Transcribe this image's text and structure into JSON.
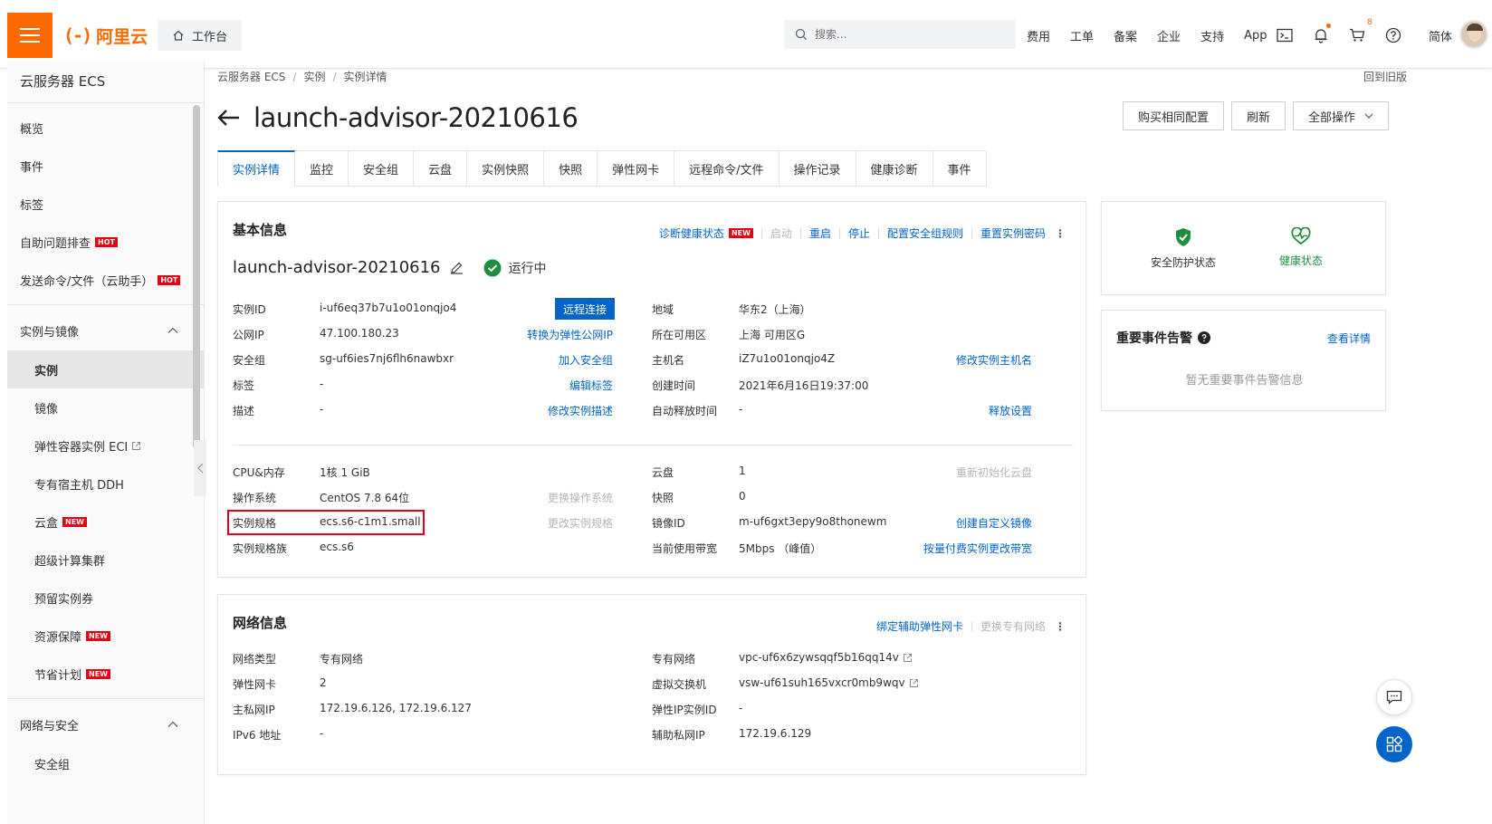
{
  "header": {
    "brand": "阿里云",
    "workbench": "工作台",
    "search_placeholder": "搜索...",
    "links": [
      "费用",
      "工单",
      "备案",
      "企业",
      "支持",
      "App"
    ],
    "cart_count": "8",
    "lang": "简体",
    "accent": "#ff6a00"
  },
  "sidebar": {
    "title": "云服务器 ECS",
    "top_items": [
      {
        "label": "概览"
      },
      {
        "label": "事件"
      },
      {
        "label": "标签"
      },
      {
        "label": "自助问题排查",
        "tag": "HOT"
      },
      {
        "label": "发送命令/文件（云助手）",
        "tag": "HOT"
      }
    ],
    "group1": "实例与镜像",
    "group1_items": [
      {
        "label": "实例"
      },
      {
        "label": "镜像"
      },
      {
        "label": "弹性容器实例 ECI"
      },
      {
        "label": "专有宿主机 DDH"
      },
      {
        "label": "云盒",
        "tag": "NEW"
      },
      {
        "label": "超级计算集群"
      },
      {
        "label": "预留实例券"
      },
      {
        "label": "资源保障",
        "tag": "NEW"
      },
      {
        "label": "节省计划",
        "tag": "NEW"
      }
    ],
    "group2": "网络与安全",
    "group2_items": [
      {
        "label": "安全组"
      }
    ]
  },
  "main": {
    "breadcrumb": [
      "云服务器 ECS",
      "实例",
      "实例详情"
    ],
    "back_old": "回到旧版",
    "title": "launch-advisor-20210616",
    "actions": {
      "buy_same": "购买相同配置",
      "refresh": "刷新",
      "all_ops": "全部操作"
    },
    "tabs": [
      "实例详情",
      "监控",
      "安全组",
      "云盘",
      "实例快照",
      "快照",
      "弹性网卡",
      "远程命令/文件",
      "操作记录",
      "健康诊断",
      "事件"
    ],
    "basic": {
      "title": "基本信息",
      "ops": {
        "diagnose": "诊断健康状态",
        "diagnose_tag": "NEW",
        "start": "启动",
        "restart": "重启",
        "stop": "停止",
        "config_sg": "配置安全组规则",
        "reset_pwd": "重置实例密码"
      },
      "instance_name": "launch-advisor-20210616",
      "status": "运行中",
      "remote_connect": "远程连接",
      "left_rows": [
        {
          "label": "实例ID",
          "value": "i-uf6eq37b7u1o01onqjo4"
        },
        {
          "label": "公网IP",
          "value": "47.100.180.23",
          "link": "转换为弹性公网IP"
        },
        {
          "label": "安全组",
          "value": "sg-uf6ies7nj6flh6nawbxr",
          "link": "加入安全组"
        },
        {
          "label": "标签",
          "value": "-",
          "link": "编辑标签"
        },
        {
          "label": "描述",
          "value": "-",
          "link": "修改实例描述"
        }
      ],
      "right_rows": [
        {
          "label": "地域",
          "value": "华东2（上海）"
        },
        {
          "label": "所在可用区",
          "value": "上海 可用区G"
        },
        {
          "label": "主机名",
          "value": "iZ7u1o01onqjo4Z",
          "link": "修改实例主机名"
        },
        {
          "label": "创建时间",
          "value": "2021年6月16日19:37:00"
        },
        {
          "label": "自动释放时间",
          "value": "-",
          "link": "释放设置"
        }
      ],
      "left_rows2": [
        {
          "label": "CPU&内存",
          "value": "1核 1 GiB"
        },
        {
          "label": "操作系统",
          "value": "CentOS 7.8 64位",
          "link": "更换操作系统",
          "disabled": true
        },
        {
          "label": "实例规格",
          "value": "ecs.s6-c1m1.small",
          "link": "更改实例规格",
          "disabled": true
        },
        {
          "label": "实例规格族",
          "value": "ecs.s6"
        }
      ],
      "right_rows2": [
        {
          "label": "云盘",
          "value": "1",
          "link": "重新初始化云盘",
          "disabled": true
        },
        {
          "label": "快照",
          "value": "0"
        },
        {
          "label": "镜像ID",
          "value": "m-uf6gxt3epy9o8thonewm",
          "link": "创建自定义镜像"
        },
        {
          "label": "当前使用带宽",
          "value": "5Mbps （峰值）",
          "link": "按量付费实例更改带宽"
        }
      ]
    },
    "network": {
      "title": "网络信息",
      "ops": {
        "bind_eni": "绑定辅助弹性网卡",
        "change_vpc": "更换专有网络"
      },
      "left_rows": [
        {
          "label": "网络类型",
          "value": "专有网络"
        },
        {
          "label": "弹性网卡",
          "value": "2"
        },
        {
          "label": "主私网IP",
          "value": "172.19.6.126, 172.19.6.127"
        },
        {
          "label": "IPv6 地址",
          "value": "-"
        }
      ],
      "right_rows": [
        {
          "label": "专有网络",
          "value": "vpc-uf6x6zywsqqf5b16qq14v"
        },
        {
          "label": "虚拟交换机",
          "value": "vsw-uf61suh165vxcr0mb9wqv"
        },
        {
          "label": "弹性IP实例ID",
          "value": "-"
        },
        {
          "label": "辅助私网IP",
          "value": "172.19.6.129"
        }
      ]
    },
    "status_card": {
      "security": "安全防护状态",
      "health": "健康状态"
    },
    "events_card": {
      "title": "重要事件告警",
      "view": "查看详情",
      "empty": "暂无重要事件告警信息"
    }
  },
  "colors": {
    "link": "#0064c8",
    "accent": "#ff6a00",
    "success": "#1e8e3e",
    "danger": "#e60012"
  }
}
